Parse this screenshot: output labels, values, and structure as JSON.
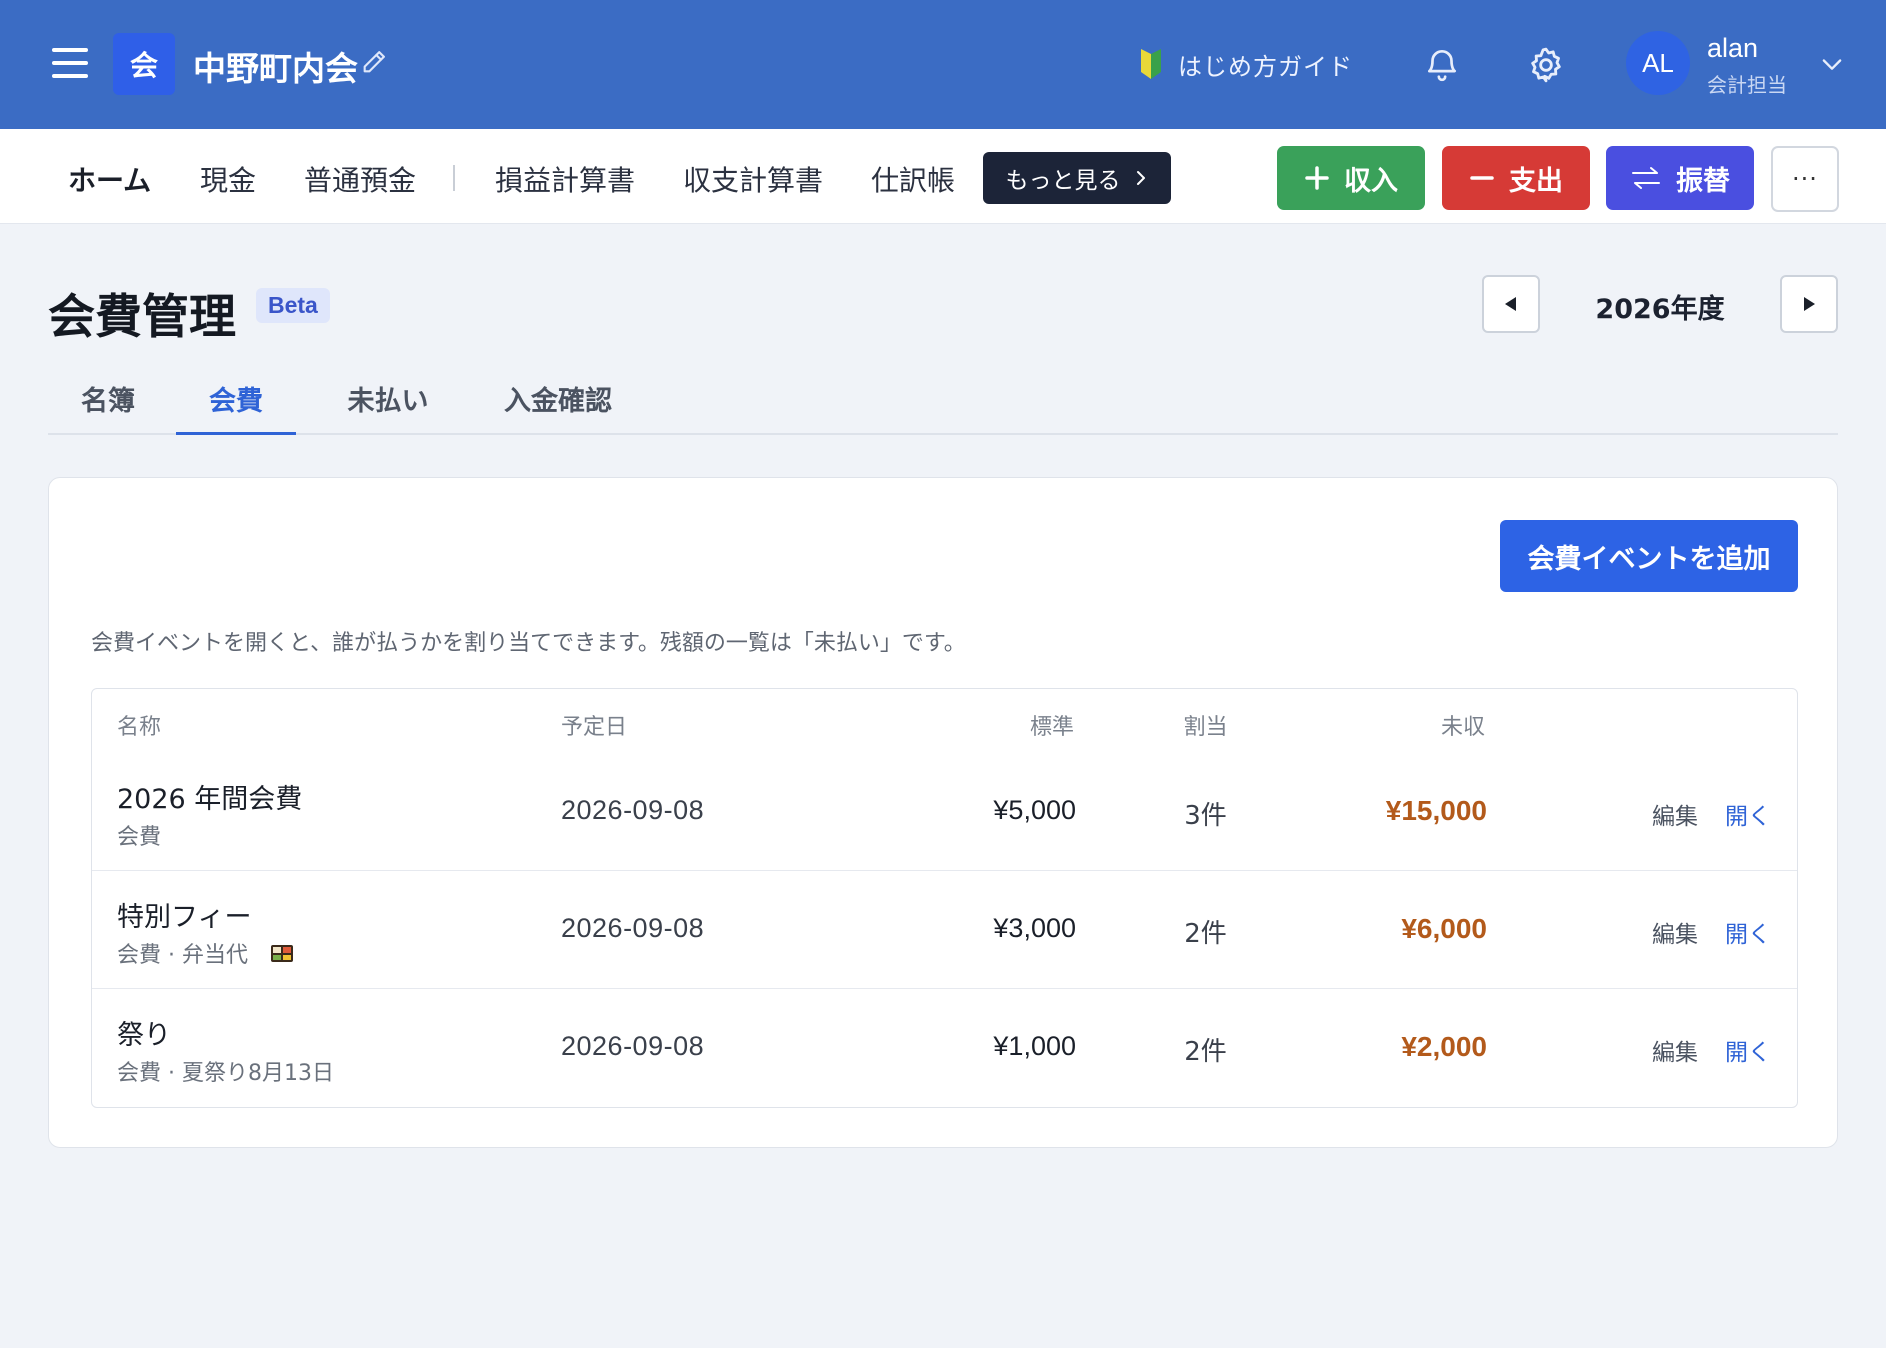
{
  "header": {
    "org_badge": "会",
    "org_name": "中野町内会",
    "guide_label": "はじめ方ガイド",
    "user": {
      "initials": "AL",
      "name": "alan",
      "role": "会計担当"
    }
  },
  "nav": {
    "items": [
      "ホーム",
      "現金",
      "普通預金",
      "損益計算書",
      "収支計算書",
      "仕訳帳"
    ],
    "more_label": "もっと見る",
    "actions": {
      "income": "収入",
      "expense": "支出",
      "transfer": "振替",
      "more": "···"
    }
  },
  "page": {
    "title": "会費管理",
    "badge": "Beta",
    "year": "2026年度"
  },
  "tabs": [
    "名簿",
    "会費",
    "未払い",
    "入金確認"
  ],
  "active_tab": "会費",
  "card": {
    "add_button": "会費イベントを追加",
    "help_text": "会費イベントを開くと、誰が払うかを割り当てできます。残額の一覧は「未払い」です。",
    "columns": [
      "名称",
      "予定日",
      "標準",
      "割当",
      "未収"
    ],
    "rows": [
      {
        "name": "2026 年間会費",
        "sub": "会費",
        "date": "2026-09-08",
        "standard": "¥5,000",
        "assigned": "3件",
        "unpaid": "¥15,000",
        "edit": "編集",
        "open": "開く"
      },
      {
        "name": "特別フィー",
        "sub": "会費 · 弁当代",
        "date": "2026-09-08",
        "standard": "¥3,000",
        "assigned": "2件",
        "unpaid": "¥6,000",
        "edit": "編集",
        "open": "開く",
        "icon": "bento-icon"
      },
      {
        "name": "祭り",
        "sub": "会費 · 夏祭り8月13日",
        "date": "2026-09-08",
        "standard": "¥1,000",
        "assigned": "2件",
        "unpaid": "¥2,000",
        "edit": "編集",
        "open": "開く"
      }
    ]
  },
  "colors": {
    "topbar": "#3b6cc4",
    "income": "#3aa15a",
    "expense": "#d63a36",
    "transfer": "#4a4fe0",
    "accent": "#2f63d6",
    "unpaid": "#b35a1b"
  }
}
